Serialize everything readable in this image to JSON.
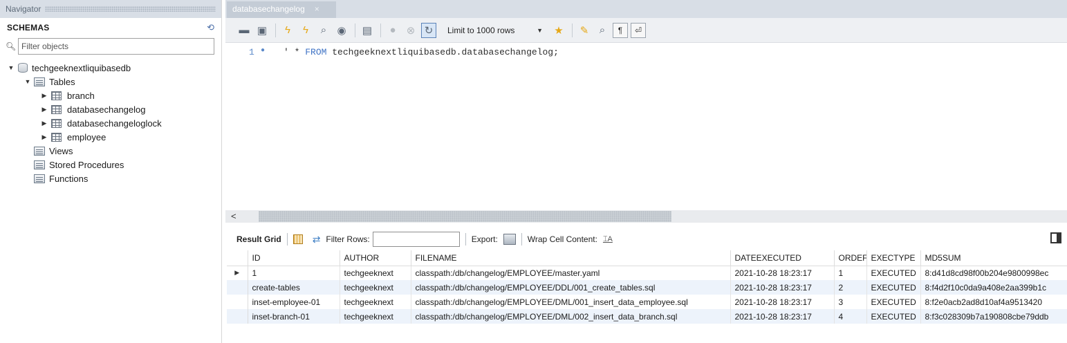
{
  "navigator": {
    "header": "Navigator",
    "schemas_title": "SCHEMAS",
    "filter_placeholder": "Filter objects",
    "schema_name": "techgeeknextliquibasedb",
    "tables_label": "Tables",
    "tables": [
      "branch",
      "databasechangelog",
      "databasechangeloglock",
      "employee"
    ],
    "views_label": "Views",
    "procedures_label": "Stored Procedures",
    "functions_label": "Functions"
  },
  "editor_tab": {
    "label": "databasechangelog",
    "close": "×"
  },
  "toolbar": {
    "limit_label": "Limit to 1000 rows"
  },
  "editor": {
    "line_number": "1",
    "code_prefix": "' * ",
    "code_keyword": "FROM",
    "code_rest": " techgeeknextliquibasedb.databasechangelog;"
  },
  "results_toolbar": {
    "result_grid": "Result Grid",
    "filter_rows": "Filter Rows:",
    "export": "Export:",
    "wrap": "Wrap Cell Content:",
    "wrap_icon": "⌶A"
  },
  "grid": {
    "columns": [
      "ID",
      "AUTHOR",
      "FILENAME",
      "DATEEXECUTED",
      "ORDEF",
      "EXECTYPE",
      "MD5SUM"
    ],
    "rows": [
      [
        "1",
        "techgeeknext",
        "classpath:/db/changelog/EMPLOYEE/master.yaml",
        "2021-10-28 18:23:17",
        "1",
        "EXECUTED",
        "8:d41d8cd98f00b204e9800998ec"
      ],
      [
        "create-tables",
        "techgeeknext",
        "classpath:/db/changelog/EMPLOYEE/DDL/001_create_tables.sql",
        "2021-10-28 18:23:17",
        "2",
        "EXECUTED",
        "8:f4d2f10c0da9a408e2aa399b1c"
      ],
      [
        "inset-employee-01",
        "techgeeknext",
        "classpath:/db/changelog/EMPLOYEE/DML/001_insert_data_employee.sql",
        "2021-10-28 18:23:17",
        "3",
        "EXECUTED",
        "8:f2e0acb2ad8d10af4a9513420"
      ],
      [
        "inset-branch-01",
        "techgeeknext",
        "classpath:/db/changelog/EMPLOYEE/DML/002_insert_data_branch.sql",
        "2021-10-28 18:23:17",
        "4",
        "EXECUTED",
        "8:f3c028309b7a190808cbe79ddb"
      ]
    ]
  }
}
